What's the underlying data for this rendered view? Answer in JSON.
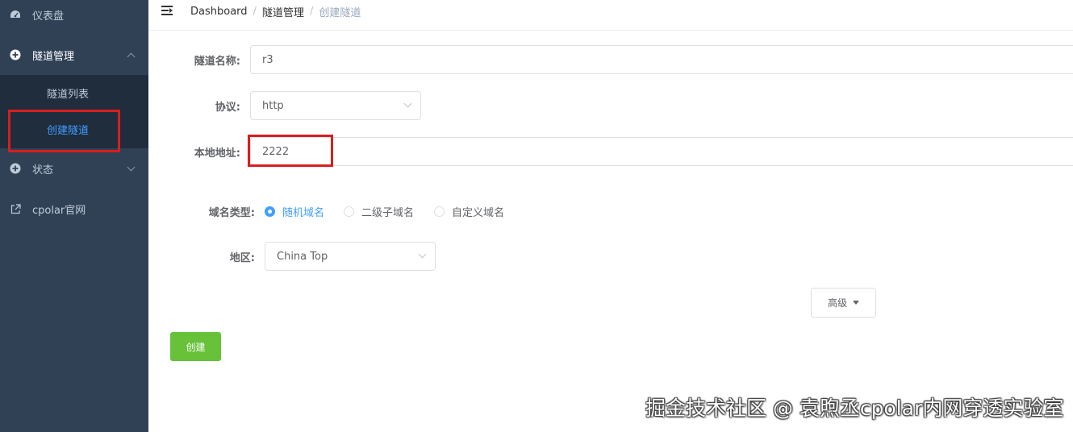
{
  "sidebar": {
    "items": [
      {
        "label": "仪表盘",
        "icon": "dashboard-icon"
      },
      {
        "label": "隧道管理",
        "icon": "plus-circle-icon"
      },
      {
        "label": "隧道列表",
        "icon": "grid-icon"
      },
      {
        "label": "创建隧道",
        "icon": "grid-icon"
      },
      {
        "label": "状态",
        "icon": "plus-circle-icon"
      },
      {
        "label": "cpolar官网",
        "icon": "external-link-icon"
      }
    ]
  },
  "header": {
    "breadcrumb": [
      "Dashboard",
      "隧道管理",
      "创建隧道"
    ],
    "separator": "/"
  },
  "form": {
    "tunnel_name_label": "隧道名称:",
    "tunnel_name_value": "r3",
    "protocol_label": "协议:",
    "protocol_value": "http",
    "local_address_label": "本地地址:",
    "local_address_value": "2222",
    "domain_type_label": "域名类型:",
    "domain_types": [
      "随机域名",
      "二级子域名",
      "自定义域名"
    ],
    "domain_type_selected": "随机域名",
    "region_label": "地区:",
    "region_value": "China Top",
    "advanced_label": "高级",
    "create_label": "创建"
  },
  "watermark": "掘金技术社区 @ 袁煦丞cpolar内网穿透实验室",
  "colors": {
    "sidebar_bg": "#304156",
    "submenu_bg": "#1f2d3d",
    "accent": "#409eff",
    "success": "#67c23a",
    "highlight_box": "#d81e1e"
  }
}
